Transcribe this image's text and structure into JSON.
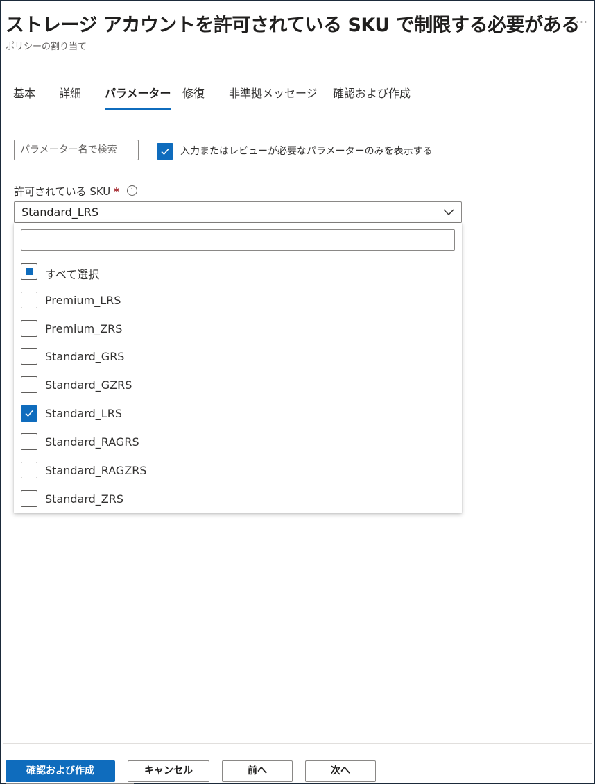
{
  "header": {
    "title": "ストレージ アカウントを許可されている SKU で制限する必要がある",
    "subtitle": "ポリシーの割り当て",
    "more_label": "···"
  },
  "tabs": [
    {
      "label": "基本",
      "active": false
    },
    {
      "label": "詳細",
      "active": false
    },
    {
      "label": "パラメーター",
      "active": true
    },
    {
      "label": "修復",
      "active": false
    },
    {
      "label": "非準拠メッセージ",
      "active": false
    },
    {
      "label": "確認および作成",
      "active": false
    }
  ],
  "filter": {
    "search_placeholder": "パラメーター名で検索",
    "checkbox_label": "入力またはレビューが必要なパラメーターのみを表示する",
    "checkbox_checked": true
  },
  "sku_field": {
    "label": "許可されている SKU",
    "required_mark": "*",
    "info_icon": "i",
    "selected_value": "Standard_LRS"
  },
  "dropdown": {
    "search_value": "",
    "select_all_label": "すべて選択",
    "select_all_state": "partial",
    "options": [
      {
        "label": "Premium_LRS",
        "checked": false
      },
      {
        "label": "Premium_ZRS",
        "checked": false
      },
      {
        "label": "Standard_GRS",
        "checked": false
      },
      {
        "label": "Standard_GZRS",
        "checked": false
      },
      {
        "label": "Standard_LRS",
        "checked": true
      },
      {
        "label": "Standard_RAGRS",
        "checked": false
      },
      {
        "label": "Standard_RAGZRS",
        "checked": false
      },
      {
        "label": "Standard_ZRS",
        "checked": false
      }
    ]
  },
  "footer": {
    "review_create_label": "確認および作成",
    "cancel_label": "キャンセル",
    "previous_label": "前へ",
    "next_label": "次へ"
  },
  "colors": {
    "accent": "#0f6cbd",
    "required": "#a4262c"
  }
}
